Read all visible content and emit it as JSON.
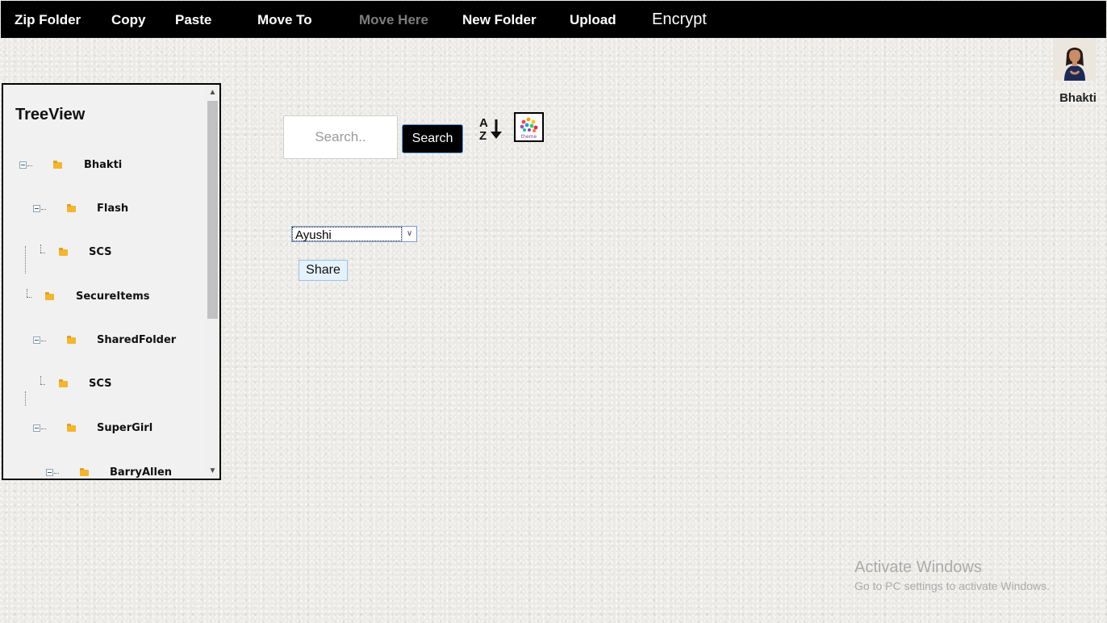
{
  "menu": {
    "zip_folder": "Zip Folder",
    "copy": "Copy",
    "paste": "Paste",
    "move_to": "Move To",
    "move_here": "Move Here",
    "new_folder": "New Folder",
    "upload": "Upload",
    "encrypt": "Encrypt"
  },
  "user": {
    "name": "Bhakti"
  },
  "tree": {
    "title": "TreeView",
    "nodes": [
      {
        "label": "Bhakti"
      },
      {
        "label": "Flash"
      },
      {
        "label": "SCS"
      },
      {
        "label": "SecureItems"
      },
      {
        "label": "SharedFolder"
      },
      {
        "label": "SCS"
      },
      {
        "label": "SuperGirl"
      },
      {
        "label": "BarryAllen"
      }
    ]
  },
  "search": {
    "placeholder": "Search..",
    "button_label": "Search"
  },
  "share": {
    "selected_user": "Ayushi",
    "button_label": "Share"
  },
  "theme_icon_label": "theme",
  "watermark": {
    "title": "Activate Windows",
    "subtitle": "Go to PC settings to activate Windows."
  },
  "colors": {
    "menubar": "#000000",
    "folder": "#f2b632",
    "search_button": "#000000",
    "share_button": "#e5f1fb"
  }
}
